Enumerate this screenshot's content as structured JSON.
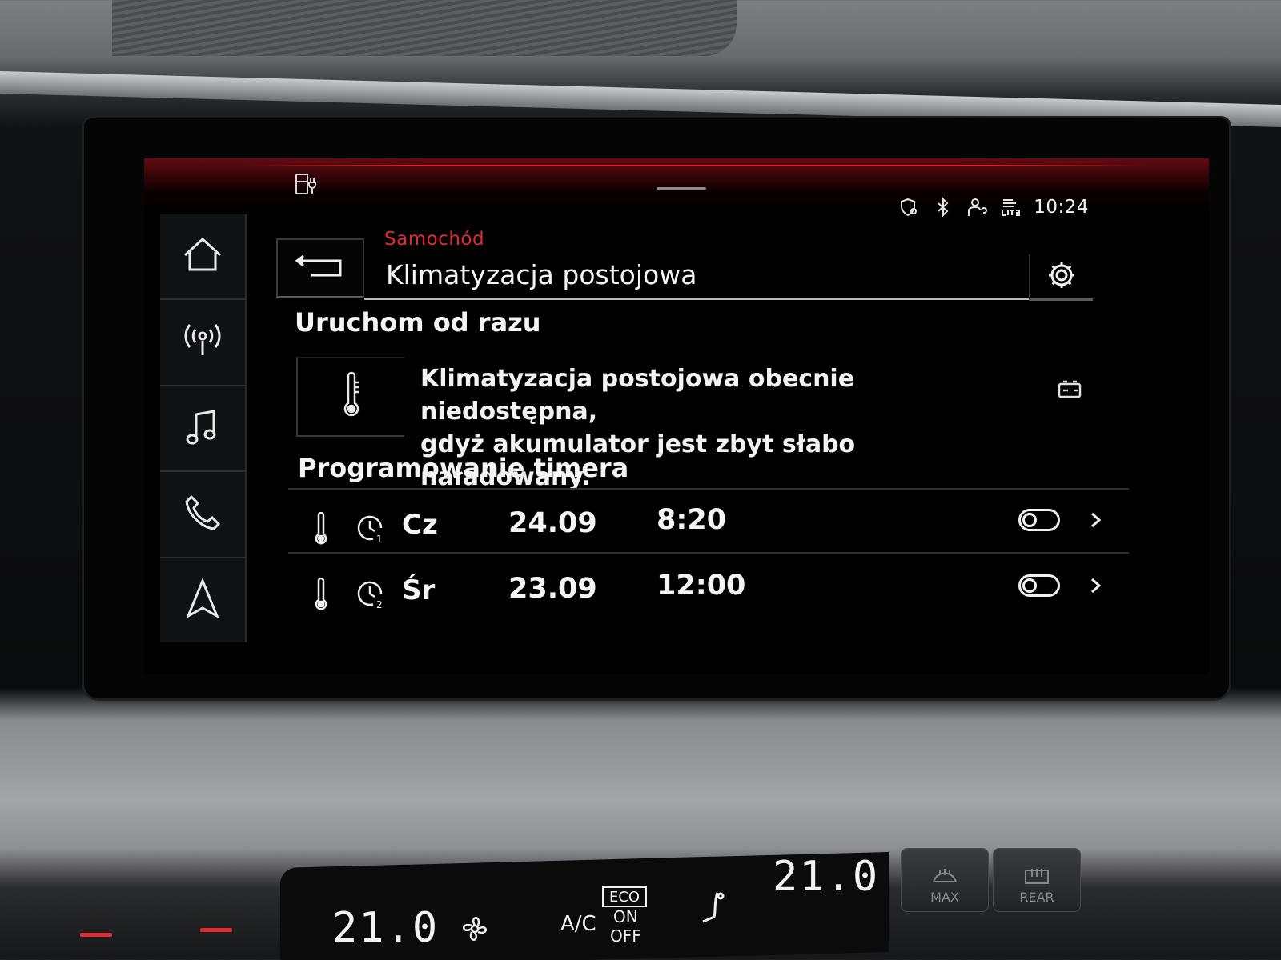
{
  "status_bar": {
    "time": "10:24",
    "icons": [
      "ev-charging-icon",
      "location-shield-icon",
      "bluetooth-icon",
      "profile-icon",
      "lte-icon"
    ]
  },
  "nav": {
    "items": [
      {
        "name": "home",
        "icon": "home-icon"
      },
      {
        "name": "radio",
        "icon": "radio-antenna-icon"
      },
      {
        "name": "media",
        "icon": "music-note-icon"
      },
      {
        "name": "phone",
        "icon": "phone-icon"
      },
      {
        "name": "navigation",
        "icon": "navigation-arrow-icon"
      }
    ]
  },
  "header": {
    "breadcrumb": "Samochód",
    "title": "Klimatyzacja postojowa"
  },
  "start_now": {
    "heading": "Uruchom od razu",
    "message_line1": "Klimatyzacja postojowa obecnie niedostępna,",
    "message_line2": "gdyż akumulator jest zbyt słabo naładowany."
  },
  "timers": {
    "heading": "Programowanie timera",
    "rows": [
      {
        "index": "1",
        "day": "Cz",
        "date": "24.09",
        "time": "8:20",
        "enabled": false
      },
      {
        "index": "2",
        "day": "Śr",
        "date": "23.09",
        "time": "12:00",
        "enabled": false
      }
    ]
  },
  "climate": {
    "left_temp": "21.0",
    "right_temp": "21.0",
    "ac_label": "A/C",
    "eco_label": "ECO",
    "on_label": "ON",
    "off_label": "OFF",
    "max_label": "MAX",
    "rear_label": "REAR"
  },
  "colors": {
    "accent_red": "#e02b35",
    "text": "#f4f4f4",
    "background": "#000000"
  }
}
